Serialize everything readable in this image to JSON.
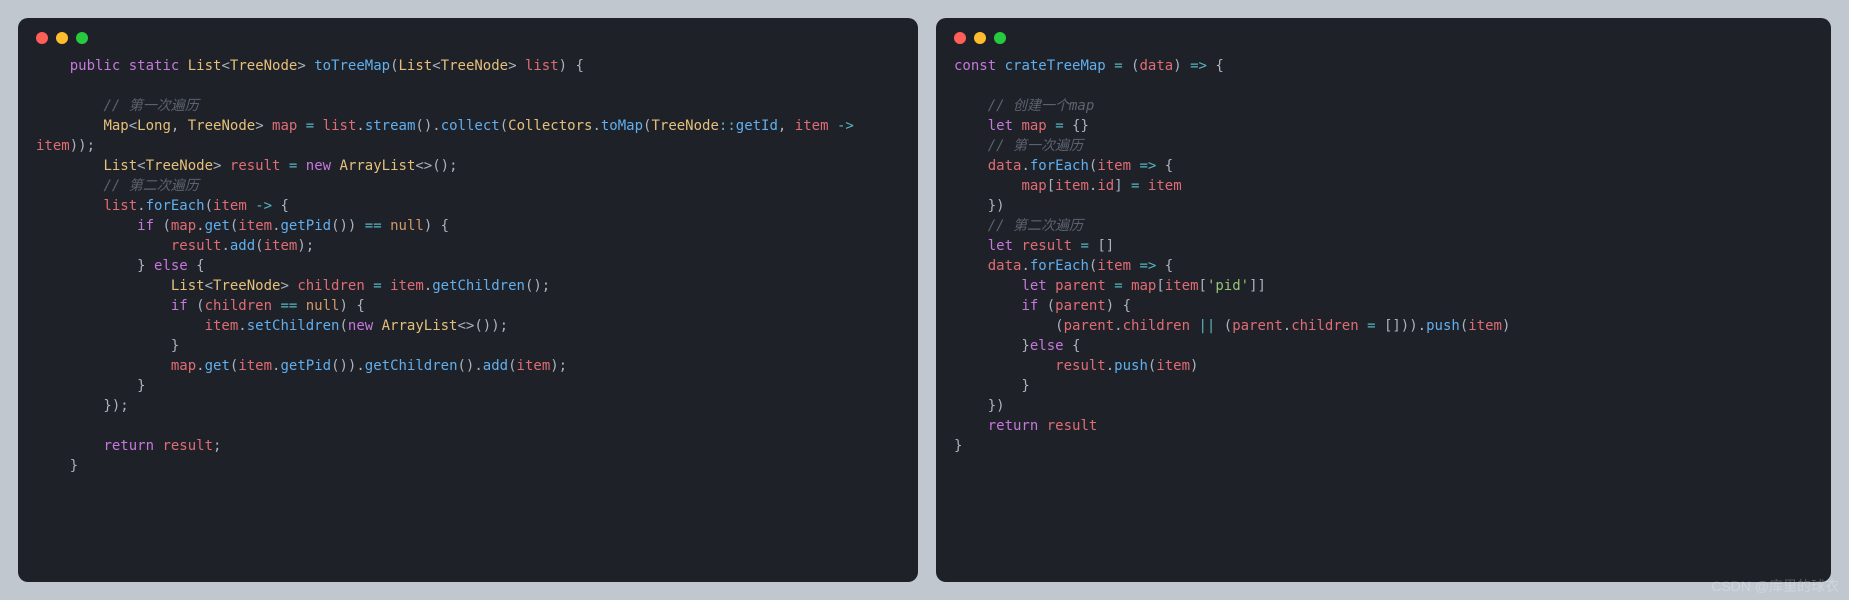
{
  "watermark": "CSDN @库里的球衣",
  "left": {
    "language": "java",
    "tokens": [
      [
        [
          "    ",
          "pn"
        ],
        [
          "public",
          "kw"
        ],
        [
          " ",
          "pn"
        ],
        [
          "static",
          "kw"
        ],
        [
          " ",
          "pn"
        ],
        [
          "List",
          "ty"
        ],
        [
          "<",
          "pn"
        ],
        [
          "TreeNode",
          "ty"
        ],
        [
          "> ",
          "pn"
        ],
        [
          "toTreeMap",
          "fn"
        ],
        [
          "(",
          "pn"
        ],
        [
          "List",
          "ty"
        ],
        [
          "<",
          "pn"
        ],
        [
          "TreeNode",
          "ty"
        ],
        [
          "> ",
          "pn"
        ],
        [
          "list",
          "id"
        ],
        [
          ") {",
          "pn"
        ]
      ],
      [],
      [
        [
          "        ",
          "pn"
        ],
        [
          "// 第一次遍历",
          "cm"
        ]
      ],
      [
        [
          "        ",
          "pn"
        ],
        [
          "Map",
          "ty"
        ],
        [
          "<",
          "pn"
        ],
        [
          "Long",
          "ty"
        ],
        [
          ", ",
          "pn"
        ],
        [
          "TreeNode",
          "ty"
        ],
        [
          "> ",
          "pn"
        ],
        [
          "map",
          "id"
        ],
        [
          " ",
          "pn"
        ],
        [
          "=",
          "op"
        ],
        [
          " ",
          "pn"
        ],
        [
          "list",
          "id"
        ],
        [
          ".",
          "pn"
        ],
        [
          "stream",
          "fn"
        ],
        [
          "().",
          "pn"
        ],
        [
          "collect",
          "fn"
        ],
        [
          "(",
          "pn"
        ],
        [
          "Collectors",
          "ty"
        ],
        [
          ".",
          "pn"
        ],
        [
          "toMap",
          "fn"
        ],
        [
          "(",
          "pn"
        ],
        [
          "TreeNode",
          "ty"
        ],
        [
          "::",
          "op"
        ],
        [
          "getId",
          "fn"
        ],
        [
          ", ",
          "pn"
        ],
        [
          "item",
          "id"
        ],
        [
          " ",
          "pn"
        ],
        [
          "->",
          "arr"
        ],
        [
          " ",
          "pn"
        ]
      ],
      [
        [
          "item",
          "id"
        ],
        [
          "));",
          "pn"
        ]
      ],
      [
        [
          "        ",
          "pn"
        ],
        [
          "List",
          "ty"
        ],
        [
          "<",
          "pn"
        ],
        [
          "TreeNode",
          "ty"
        ],
        [
          "> ",
          "pn"
        ],
        [
          "result",
          "id"
        ],
        [
          " ",
          "pn"
        ],
        [
          "=",
          "op"
        ],
        [
          " ",
          "pn"
        ],
        [
          "new",
          "kw"
        ],
        [
          " ",
          "pn"
        ],
        [
          "ArrayList",
          "ty"
        ],
        [
          "<>();",
          "pn"
        ]
      ],
      [
        [
          "        ",
          "pn"
        ],
        [
          "// 第二次遍历",
          "cm"
        ]
      ],
      [
        [
          "        ",
          "pn"
        ],
        [
          "list",
          "id"
        ],
        [
          ".",
          "pn"
        ],
        [
          "forEach",
          "fn"
        ],
        [
          "(",
          "pn"
        ],
        [
          "item",
          "id"
        ],
        [
          " ",
          "pn"
        ],
        [
          "->",
          "arr"
        ],
        [
          " {",
          "pn"
        ]
      ],
      [
        [
          "            ",
          "pn"
        ],
        [
          "if",
          "kw"
        ],
        [
          " (",
          "pn"
        ],
        [
          "map",
          "id"
        ],
        [
          ".",
          "pn"
        ],
        [
          "get",
          "fn"
        ],
        [
          "(",
          "pn"
        ],
        [
          "item",
          "id"
        ],
        [
          ".",
          "pn"
        ],
        [
          "getPid",
          "fn"
        ],
        [
          "()) ",
          "pn"
        ],
        [
          "==",
          "op"
        ],
        [
          " ",
          "pn"
        ],
        [
          "null",
          "lit"
        ],
        [
          ") {",
          "pn"
        ]
      ],
      [
        [
          "                ",
          "pn"
        ],
        [
          "result",
          "id"
        ],
        [
          ".",
          "pn"
        ],
        [
          "add",
          "fn"
        ],
        [
          "(",
          "pn"
        ],
        [
          "item",
          "id"
        ],
        [
          ");",
          "pn"
        ]
      ],
      [
        [
          "            } ",
          "pn"
        ],
        [
          "else",
          "kw"
        ],
        [
          " {",
          "pn"
        ]
      ],
      [
        [
          "                ",
          "pn"
        ],
        [
          "List",
          "ty"
        ],
        [
          "<",
          "pn"
        ],
        [
          "TreeNode",
          "ty"
        ],
        [
          "> ",
          "pn"
        ],
        [
          "children",
          "id"
        ],
        [
          " ",
          "pn"
        ],
        [
          "=",
          "op"
        ],
        [
          " ",
          "pn"
        ],
        [
          "item",
          "id"
        ],
        [
          ".",
          "pn"
        ],
        [
          "getChildren",
          "fn"
        ],
        [
          "();",
          "pn"
        ]
      ],
      [
        [
          "                ",
          "pn"
        ],
        [
          "if",
          "kw"
        ],
        [
          " (",
          "pn"
        ],
        [
          "children",
          "id"
        ],
        [
          " ",
          "pn"
        ],
        [
          "==",
          "op"
        ],
        [
          " ",
          "pn"
        ],
        [
          "null",
          "lit"
        ],
        [
          ") {",
          "pn"
        ]
      ],
      [
        [
          "                    ",
          "pn"
        ],
        [
          "item",
          "id"
        ],
        [
          ".",
          "pn"
        ],
        [
          "setChildren",
          "fn"
        ],
        [
          "(",
          "pn"
        ],
        [
          "new",
          "kw"
        ],
        [
          " ",
          "pn"
        ],
        [
          "ArrayList",
          "ty"
        ],
        [
          "<>());",
          "pn"
        ]
      ],
      [
        [
          "                }",
          "pn"
        ]
      ],
      [
        [
          "                ",
          "pn"
        ],
        [
          "map",
          "id"
        ],
        [
          ".",
          "pn"
        ],
        [
          "get",
          "fn"
        ],
        [
          "(",
          "pn"
        ],
        [
          "item",
          "id"
        ],
        [
          ".",
          "pn"
        ],
        [
          "getPid",
          "fn"
        ],
        [
          "()).",
          "pn"
        ],
        [
          "getChildren",
          "fn"
        ],
        [
          "().",
          "pn"
        ],
        [
          "add",
          "fn"
        ],
        [
          "(",
          "pn"
        ],
        [
          "item",
          "id"
        ],
        [
          ");",
          "pn"
        ]
      ],
      [
        [
          "            }",
          "pn"
        ]
      ],
      [
        [
          "        });",
          "pn"
        ]
      ],
      [],
      [
        [
          "        ",
          "pn"
        ],
        [
          "return",
          "kw"
        ],
        [
          " ",
          "pn"
        ],
        [
          "result",
          "id"
        ],
        [
          ";",
          "pn"
        ]
      ],
      [
        [
          "    }",
          "pn"
        ]
      ]
    ]
  },
  "right": {
    "language": "javascript",
    "tokens": [
      [
        [
          "const",
          "kw"
        ],
        [
          " ",
          "pn"
        ],
        [
          "crateTreeMap",
          "fn"
        ],
        [
          " ",
          "pn"
        ],
        [
          "=",
          "op"
        ],
        [
          " (",
          "pn"
        ],
        [
          "data",
          "id"
        ],
        [
          ") ",
          "pn"
        ],
        [
          "=>",
          "arr"
        ],
        [
          " {",
          "pn"
        ]
      ],
      [],
      [
        [
          "    ",
          "pn"
        ],
        [
          "// 创建一个map",
          "cm"
        ]
      ],
      [
        [
          "    ",
          "pn"
        ],
        [
          "let",
          "kw"
        ],
        [
          " ",
          "pn"
        ],
        [
          "map",
          "id"
        ],
        [
          " ",
          "pn"
        ],
        [
          "=",
          "op"
        ],
        [
          " {}",
          "pn"
        ]
      ],
      [
        [
          "    ",
          "pn"
        ],
        [
          "// 第一次遍历",
          "cm"
        ]
      ],
      [
        [
          "    ",
          "pn"
        ],
        [
          "data",
          "id"
        ],
        [
          ".",
          "pn"
        ],
        [
          "forEach",
          "fn"
        ],
        [
          "(",
          "pn"
        ],
        [
          "item",
          "id"
        ],
        [
          " ",
          "pn"
        ],
        [
          "=>",
          "arr"
        ],
        [
          " {",
          "pn"
        ]
      ],
      [
        [
          "        ",
          "pn"
        ],
        [
          "map",
          "id"
        ],
        [
          "[",
          "pn"
        ],
        [
          "item",
          "id"
        ],
        [
          ".",
          "pn"
        ],
        [
          "id",
          "id"
        ],
        [
          "] ",
          "pn"
        ],
        [
          "=",
          "op"
        ],
        [
          " ",
          "pn"
        ],
        [
          "item",
          "id"
        ]
      ],
      [
        [
          "    })",
          "pn"
        ]
      ],
      [
        [
          "    ",
          "pn"
        ],
        [
          "// 第二次遍历",
          "cm"
        ]
      ],
      [
        [
          "    ",
          "pn"
        ],
        [
          "let",
          "kw"
        ],
        [
          " ",
          "pn"
        ],
        [
          "result",
          "id"
        ],
        [
          " ",
          "pn"
        ],
        [
          "=",
          "op"
        ],
        [
          " []",
          "pn"
        ]
      ],
      [
        [
          "    ",
          "pn"
        ],
        [
          "data",
          "id"
        ],
        [
          ".",
          "pn"
        ],
        [
          "forEach",
          "fn"
        ],
        [
          "(",
          "pn"
        ],
        [
          "item",
          "id"
        ],
        [
          " ",
          "pn"
        ],
        [
          "=>",
          "arr"
        ],
        [
          " {",
          "pn"
        ]
      ],
      [
        [
          "        ",
          "pn"
        ],
        [
          "let",
          "kw"
        ],
        [
          " ",
          "pn"
        ],
        [
          "parent",
          "id"
        ],
        [
          " ",
          "pn"
        ],
        [
          "=",
          "op"
        ],
        [
          " ",
          "pn"
        ],
        [
          "map",
          "id"
        ],
        [
          "[",
          "pn"
        ],
        [
          "item",
          "id"
        ],
        [
          "[",
          "pn"
        ],
        [
          "'pid'",
          "str"
        ],
        [
          "]]",
          "pn"
        ]
      ],
      [
        [
          "        ",
          "pn"
        ],
        [
          "if",
          "kw"
        ],
        [
          " (",
          "pn"
        ],
        [
          "parent",
          "id"
        ],
        [
          ") {",
          "pn"
        ]
      ],
      [
        [
          "            (",
          "pn"
        ],
        [
          "parent",
          "id"
        ],
        [
          ".",
          "pn"
        ],
        [
          "children",
          "id"
        ],
        [
          " ",
          "pn"
        ],
        [
          "||",
          "op"
        ],
        [
          " (",
          "pn"
        ],
        [
          "parent",
          "id"
        ],
        [
          ".",
          "pn"
        ],
        [
          "children",
          "id"
        ],
        [
          " ",
          "pn"
        ],
        [
          "=",
          "op"
        ],
        [
          " [])).",
          "pn"
        ],
        [
          "push",
          "fn"
        ],
        [
          "(",
          "pn"
        ],
        [
          "item",
          "id"
        ],
        [
          ")",
          "pn"
        ]
      ],
      [
        [
          "        }",
          "pn"
        ],
        [
          "else",
          "kw"
        ],
        [
          " {",
          "pn"
        ]
      ],
      [
        [
          "            ",
          "pn"
        ],
        [
          "result",
          "id"
        ],
        [
          ".",
          "pn"
        ],
        [
          "push",
          "fn"
        ],
        [
          "(",
          "pn"
        ],
        [
          "item",
          "id"
        ],
        [
          ")",
          "pn"
        ]
      ],
      [
        [
          "        }",
          "pn"
        ]
      ],
      [
        [
          "    })",
          "pn"
        ]
      ],
      [
        [
          "    ",
          "pn"
        ],
        [
          "return",
          "kw"
        ],
        [
          " ",
          "pn"
        ],
        [
          "result",
          "id"
        ]
      ],
      [
        [
          "}",
          "pn"
        ]
      ]
    ]
  }
}
